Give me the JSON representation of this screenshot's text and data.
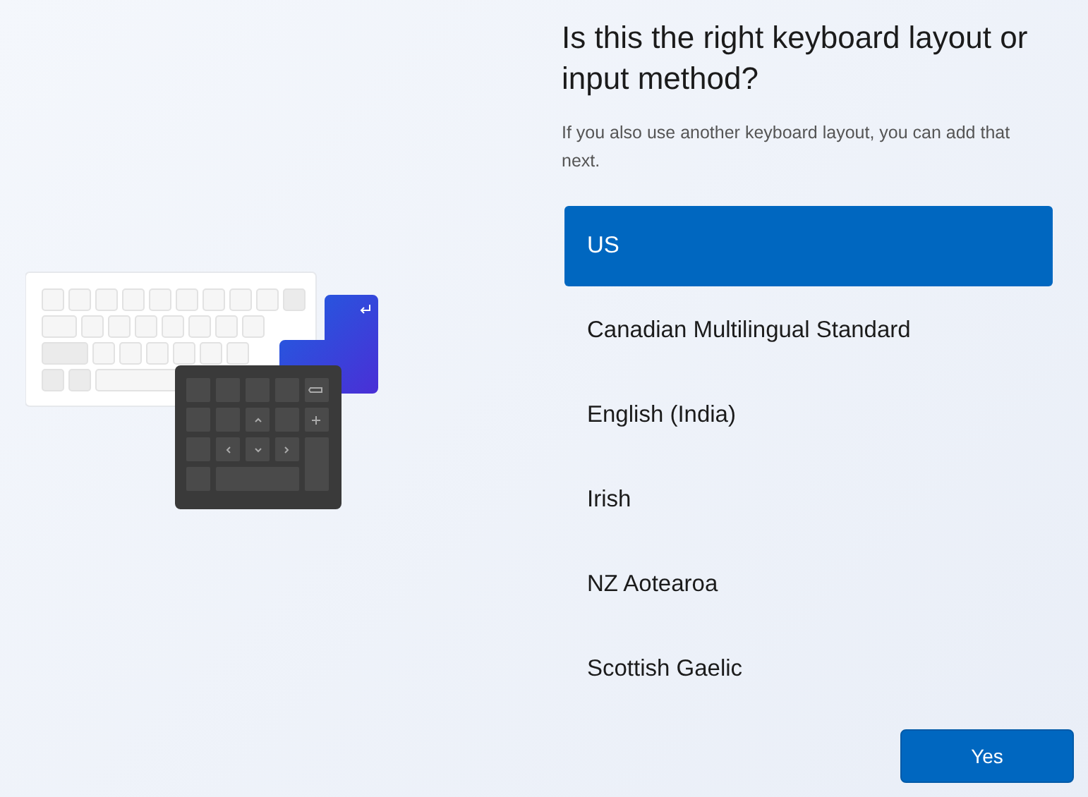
{
  "heading": "Is this the right keyboard layout or input method?",
  "subtext": "If you also use another keyboard layout, you can add that next.",
  "layouts": [
    {
      "label": "US",
      "selected": true
    },
    {
      "label": "Canadian Multilingual Standard",
      "selected": false
    },
    {
      "label": "English (India)",
      "selected": false
    },
    {
      "label": "Irish",
      "selected": false
    },
    {
      "label": "NZ Aotearoa",
      "selected": false
    },
    {
      "label": "Scottish Gaelic",
      "selected": false
    }
  ],
  "buttons": [
    {
      "label": "Yes",
      "kind": "primary"
    }
  ]
}
